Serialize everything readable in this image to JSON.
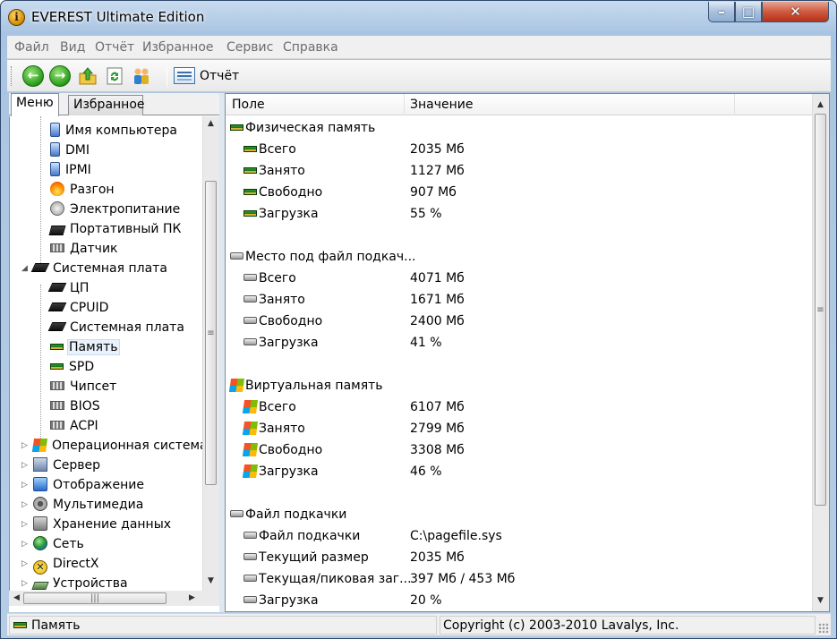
{
  "window": {
    "title": "EVEREST Ultimate Edition",
    "app_icon_glyph": "i",
    "controls": {
      "minimize": "–",
      "maximize": "□",
      "close": "✕"
    }
  },
  "menu": [
    "Файл",
    "Вид",
    "Отчёт",
    "Избранное",
    "Сервис",
    "Справка"
  ],
  "toolbar": {
    "back_glyph": "←",
    "forward_glyph": "→",
    "report_label": "Отчёт"
  },
  "left": {
    "tabs": [
      "Меню",
      "Избранное"
    ],
    "tree": [
      {
        "label": "Имя компьютера",
        "icon": "computer-icon",
        "level": 2
      },
      {
        "label": "DMI",
        "icon": "computer-icon",
        "level": 2
      },
      {
        "label": "IPMI",
        "icon": "computer-icon",
        "level": 2
      },
      {
        "label": "Разгон",
        "icon": "fire-icon",
        "level": 2
      },
      {
        "label": "Электропитание",
        "icon": "power-icon",
        "level": 2
      },
      {
        "label": "Портативный ПК",
        "icon": "laptop-icon",
        "level": 2
      },
      {
        "label": "Датчик",
        "icon": "sensor-icon",
        "level": 2
      },
      {
        "label": "Системная плата",
        "icon": "motherboard-icon",
        "level": 1,
        "expander": "◢"
      },
      {
        "label": "ЦП",
        "icon": "cpu-icon",
        "level": 2
      },
      {
        "label": "CPUID",
        "icon": "cpu-icon",
        "level": 2
      },
      {
        "label": "Системная плата",
        "icon": "motherboard-icon",
        "level": 2
      },
      {
        "label": "Память",
        "icon": "memory-icon",
        "level": 2,
        "selected": true
      },
      {
        "label": "SPD",
        "icon": "memory-icon",
        "level": 2
      },
      {
        "label": "Чипсет",
        "icon": "chipset-icon",
        "level": 2
      },
      {
        "label": "BIOS",
        "icon": "chip-icon",
        "level": 2
      },
      {
        "label": "ACPI",
        "icon": "chip-icon",
        "level": 2
      },
      {
        "label": "Операционная система",
        "icon": "windows-icon",
        "level": 1,
        "expander": "▷"
      },
      {
        "label": "Сервер",
        "icon": "server-icon",
        "level": 1,
        "expander": "▷"
      },
      {
        "label": "Отображение",
        "icon": "display-icon",
        "level": 1,
        "expander": "▷"
      },
      {
        "label": "Мультимедиа",
        "icon": "speaker-icon",
        "level": 1,
        "expander": "▷"
      },
      {
        "label": "Хранение данных",
        "icon": "storage-icon",
        "level": 1,
        "expander": "▷"
      },
      {
        "label": "Сеть",
        "icon": "network-icon",
        "level": 1,
        "expander": "▷"
      },
      {
        "label": "DirectX",
        "icon": "directx-icon",
        "level": 1,
        "expander": "▷"
      },
      {
        "label": "Устройства",
        "icon": "devices-icon",
        "level": 1,
        "expander": "▷"
      }
    ]
  },
  "table": {
    "columns": [
      "Поле",
      "Значение"
    ],
    "rows": [
      {
        "type": "group",
        "field": "Физическая память",
        "icon": "memory-icon"
      },
      {
        "field": "Всего",
        "value": "2035 Мб",
        "icon": "memory-icon"
      },
      {
        "field": "Занято",
        "value": "1127 Мб",
        "icon": "memory-icon"
      },
      {
        "field": "Свободно",
        "value": "907 Мб",
        "icon": "memory-icon"
      },
      {
        "field": "Загрузка",
        "value": "55 %",
        "icon": "memory-icon"
      },
      {
        "type": "spacer"
      },
      {
        "type": "group",
        "field": "Место под файл подкач...",
        "icon": "disk-icon"
      },
      {
        "field": "Всего",
        "value": "4071 Мб",
        "icon": "disk-icon"
      },
      {
        "field": "Занято",
        "value": "1671 Мб",
        "icon": "disk-icon"
      },
      {
        "field": "Свободно",
        "value": "2400 Мб",
        "icon": "disk-icon"
      },
      {
        "field": "Загрузка",
        "value": "41 %",
        "icon": "disk-icon"
      },
      {
        "type": "spacer"
      },
      {
        "type": "group",
        "field": "Виртуальная память",
        "icon": "windows-icon"
      },
      {
        "field": "Всего",
        "value": "6107 Мб",
        "icon": "windows-icon"
      },
      {
        "field": "Занято",
        "value": "2799 Мб",
        "icon": "windows-icon"
      },
      {
        "field": "Свободно",
        "value": "3308 Мб",
        "icon": "windows-icon"
      },
      {
        "field": "Загрузка",
        "value": "46 %",
        "icon": "windows-icon"
      },
      {
        "type": "spacer"
      },
      {
        "type": "group",
        "field": "Файл подкачки",
        "icon": "disk-icon"
      },
      {
        "field": "Файл подкачки",
        "value": "C:\\pagefile.sys",
        "icon": "disk-icon"
      },
      {
        "field": "Текущий размер",
        "value": "2035 Мб",
        "icon": "disk-icon"
      },
      {
        "field": "Текущая/пиковая заг...",
        "value": "397 Мб / 453 Мб",
        "icon": "disk-icon"
      },
      {
        "field": "Загрузка",
        "value": "20 %",
        "icon": "disk-icon"
      }
    ]
  },
  "status": {
    "left": "Память",
    "right": "Copyright (c) 2003-2010 Lavalys, Inc."
  }
}
